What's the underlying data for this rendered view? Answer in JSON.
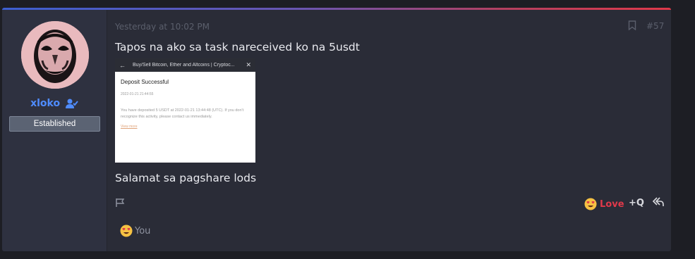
{
  "post": {
    "timestamp": "Yesterday at 10:02 PM",
    "number": "#57",
    "message_line1": "Tapos na ako sa task nareceived ko na 5usdt",
    "message_line2": "Salamat sa pagshare lods"
  },
  "user": {
    "name": "xloko",
    "badge": "Established",
    "avatar_icon": "avatar-face",
    "user_check_icon": "user-check-icon"
  },
  "screenshot": {
    "bar_title": "Buy/Sell Bitcoin, Ether and Altcoins | Cryptoc...",
    "back_glyph": "←",
    "close_glyph": "✕",
    "heading": "Deposit Successful",
    "date": "2022-01-21 21:44:55",
    "text": "You have deposited 5 USDT at 2022-01-21 13:44:48 (UTC). If you don't recognize this activity, please contact us immediately.",
    "link": "View more"
  },
  "actions": {
    "love_label": "Love",
    "quote_label": "+Q"
  },
  "reactions": {
    "label": "You"
  },
  "colors": {
    "accent_blue": "#4f8cff",
    "love_red": "#e0394a",
    "card_bg": "#2a2c37"
  }
}
